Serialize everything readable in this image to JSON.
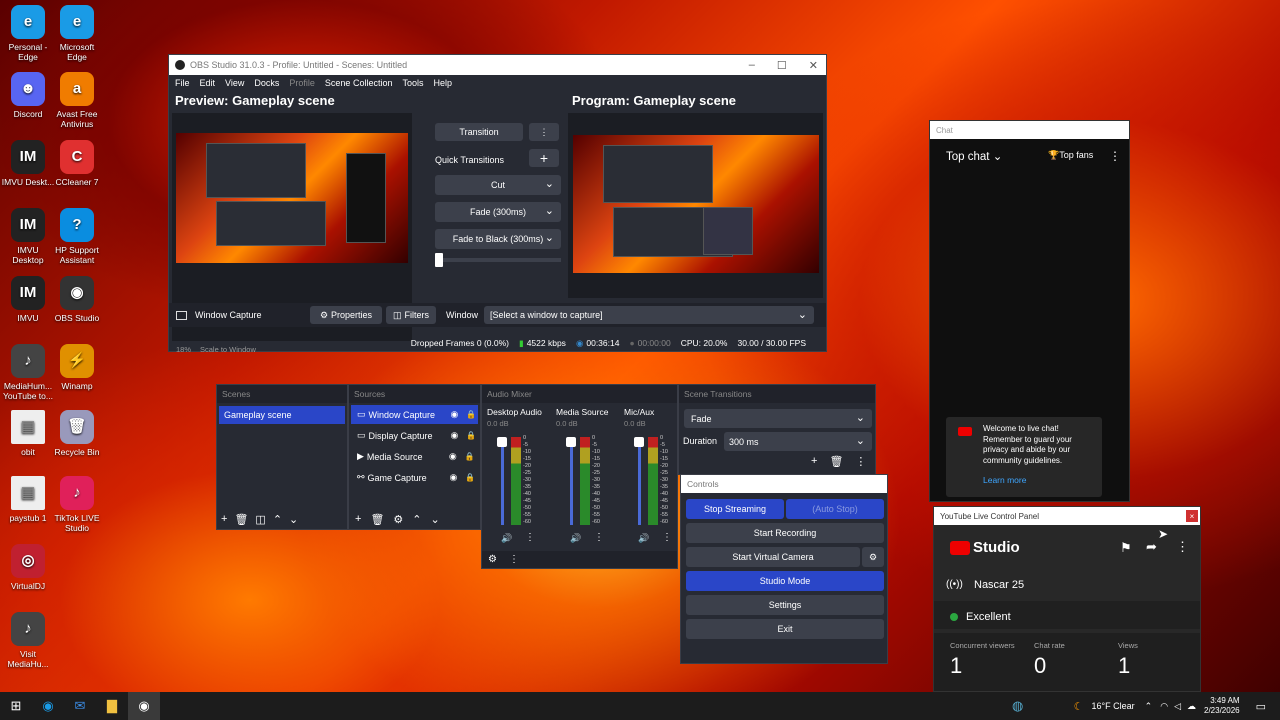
{
  "desktop": {
    "icons": [
      {
        "label": "Personal - Edge",
        "glyph": "e",
        "color": "#1a9be6"
      },
      {
        "label": "Microsoft Edge",
        "glyph": "e",
        "color": "#1a9be6"
      },
      {
        "label": "Discord",
        "glyph": "☻",
        "color": "#5865f2"
      },
      {
        "label": "Avast Free Antivirus",
        "glyph": "a",
        "color": "#f07c00"
      },
      {
        "label": "IMVU Deskt...",
        "glyph": "IM",
        "color": "#222"
      },
      {
        "label": "CCleaner 7",
        "glyph": "C",
        "color": "#e03030"
      },
      {
        "label": "IMVU Desktop",
        "glyph": "IM",
        "color": "#222"
      },
      {
        "label": "HP Support Assistant",
        "glyph": "?",
        "color": "#0a8de0"
      },
      {
        "label": "IMVU",
        "glyph": "IM",
        "color": "#222"
      },
      {
        "label": "OBS Studio",
        "glyph": "◉",
        "color": "#333"
      },
      {
        "label": "MediaHum... YouTube to...",
        "glyph": "♪",
        "color": "#444"
      },
      {
        "label": "Winamp",
        "glyph": "⚡",
        "color": "#e09000"
      },
      {
        "label": "obit",
        "glyph": "▤",
        "color": "#eee"
      },
      {
        "label": "Recycle Bin",
        "glyph": "🗑",
        "color": "#99b"
      },
      {
        "label": "paystub 1",
        "glyph": "▤",
        "color": "#eee"
      },
      {
        "label": "TikTok LIVE Studio",
        "glyph": "♪",
        "color": "#e0205a"
      },
      {
        "label": "VirtualDJ",
        "glyph": "◎",
        "color": "#c02030"
      },
      {
        "label": "Visit MediaHu...",
        "glyph": "♪",
        "color": "#444"
      }
    ]
  },
  "obs": {
    "title": "OBS Studio 31.0.3 - Profile: Untitled - Scenes: Untitled",
    "menu": [
      "File",
      "Edit",
      "View",
      "Docks",
      "Profile",
      "Scene Collection",
      "Tools",
      "Help"
    ],
    "preview_title": "Preview: Gameplay scene",
    "program_title": "Program: Gameplay scene",
    "transition_btn": "Transition",
    "quick_transitions": "Quick Transitions",
    "cut": "Cut",
    "fade": "Fade (300ms)",
    "fade_black": "Fade to Black (300ms)",
    "zoom": "18%",
    "scale": "Scale to Window",
    "source_name": "Window Capture",
    "properties": "Properties",
    "filters": "Filters",
    "window_label": "Window",
    "window_value": "[Select a window to capture]",
    "status": {
      "dropped": "Dropped Frames 0 (0.0%)",
      "kbps": "4522 kbps",
      "live_time": "00:36:14",
      "rec_time": "00:00:00",
      "cpu": "CPU: 20.0%",
      "fps": "30.00 / 30.00 FPS"
    }
  },
  "docks": {
    "scenes_title": "Scenes",
    "scenes": [
      "Gameplay scene"
    ],
    "sources_title": "Sources",
    "sources": [
      "Window Capture",
      "Display Capture",
      "Media Source",
      "Game Capture"
    ],
    "mixer_title": "Audio Mixer",
    "channels": [
      {
        "name": "Desktop Audio",
        "db": "0.0 dB"
      },
      {
        "name": "Media Source",
        "db": "0.0 dB"
      },
      {
        "name": "Mic/Aux",
        "db": "0.0 dB"
      }
    ],
    "meter_ticks": [
      "0",
      "-5",
      "-10",
      "-15",
      "-20",
      "-25",
      "-30",
      "-35",
      "-40",
      "-45",
      "-50",
      "-55",
      "-60"
    ],
    "transitions_title": "Scene Transitions",
    "transition_value": "Fade",
    "duration_label": "Duration",
    "duration_value": "300 ms",
    "controls_title": "Controls",
    "stop_streaming": "Stop Streaming",
    "auto_stop": "(Auto Stop)",
    "start_recording": "Start Recording",
    "start_virtual_camera": "Start Virtual Camera",
    "studio_mode": "Studio Mode",
    "settings": "Settings",
    "exit": "Exit"
  },
  "chat": {
    "title": "Chat",
    "top_chat": "Top chat",
    "top_fans": "Top fans",
    "welcome": "Welcome to live chat! Remember to guard your privacy and abide by our community guidelines.",
    "learn_more": "Learn more"
  },
  "yt": {
    "title": "YouTube Live Control Panel",
    "logo": "Studio",
    "stream_name": "Nascar 25",
    "health": "Excellent",
    "stats": [
      {
        "label": "Concurrent viewers",
        "value": "1"
      },
      {
        "label": "Chat rate",
        "value": "0"
      },
      {
        "label": "Views",
        "value": "1"
      }
    ]
  },
  "taskbar": {
    "weather": "16°F Clear",
    "time": "3:49 AM",
    "date": "2/23/2026"
  },
  "colors": {
    "accent": "#2a46c8",
    "obs_bg": "#272a33",
    "panel": "#1e2028"
  }
}
